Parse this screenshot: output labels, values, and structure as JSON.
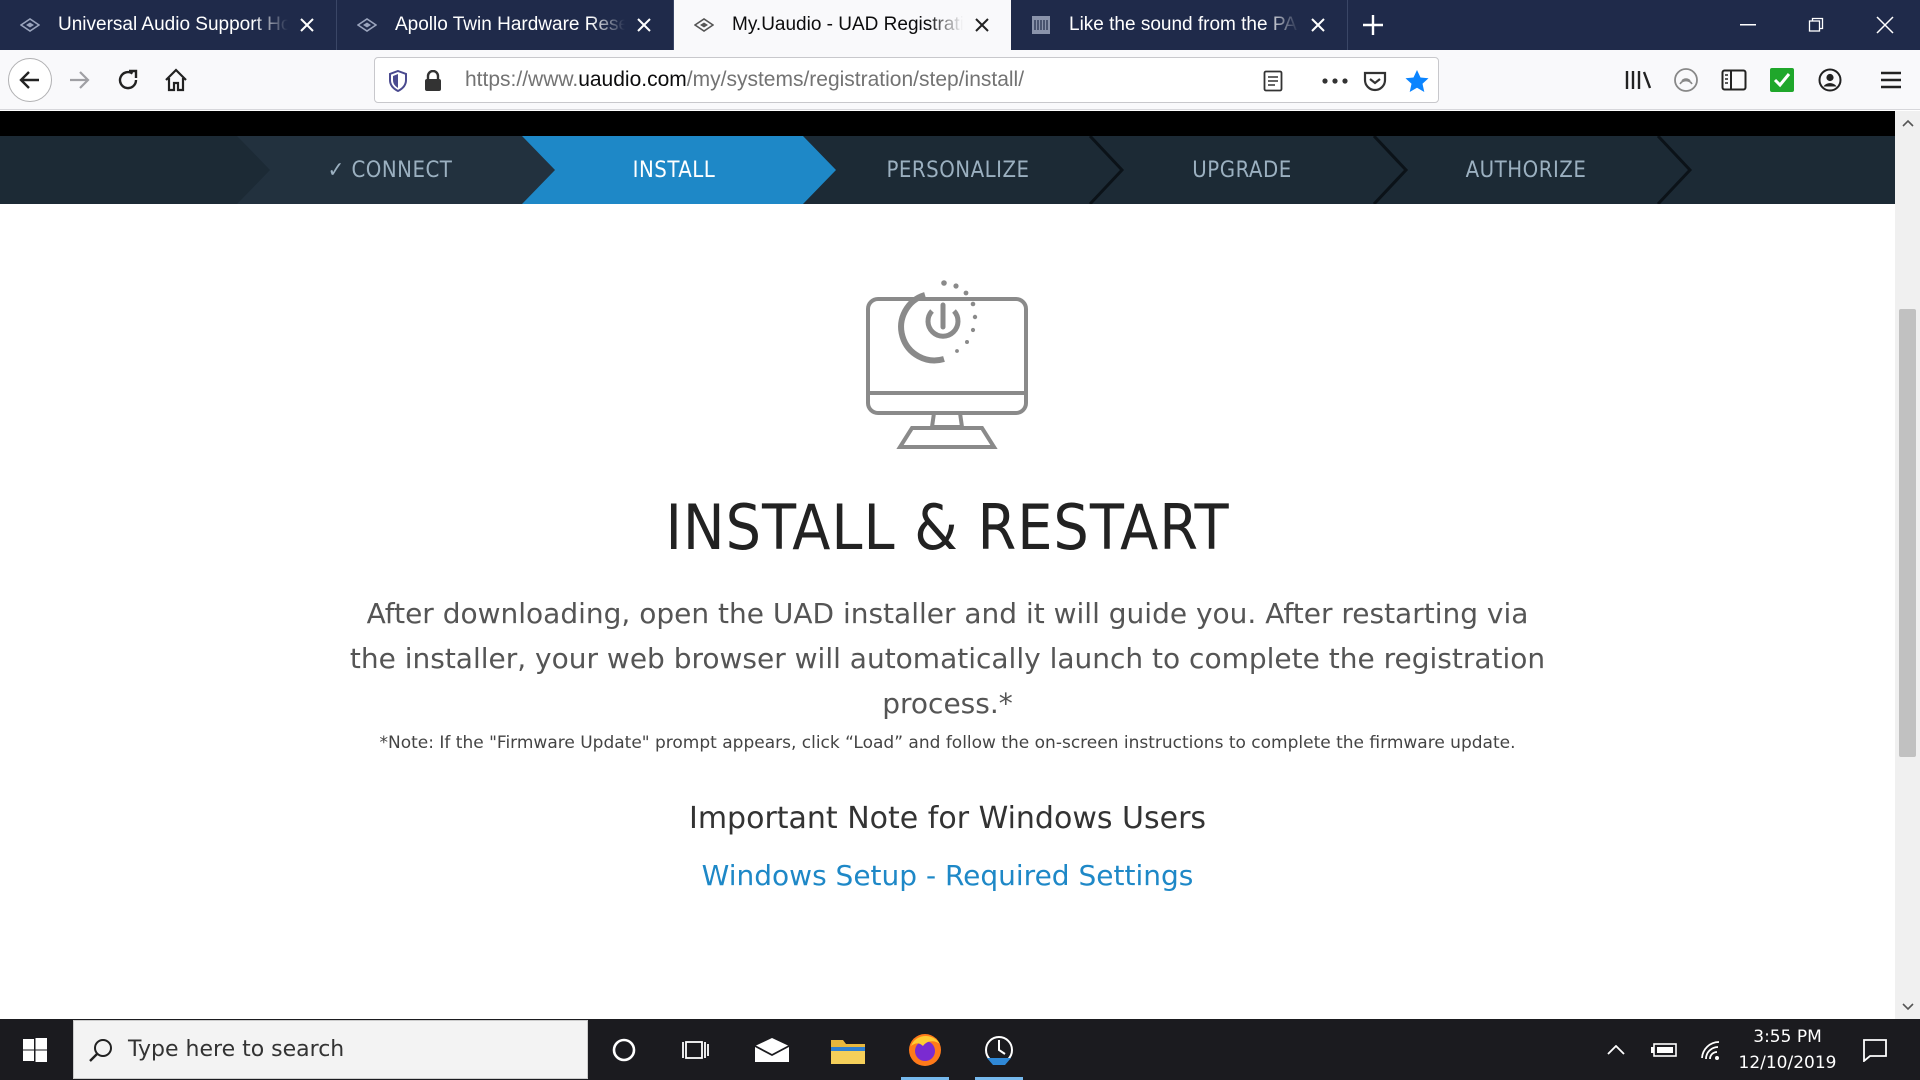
{
  "browser": {
    "tabs": [
      {
        "title": "Universal Audio Support Home",
        "active": false
      },
      {
        "title": "Apollo Twin Hardware Reset – Universal Audio",
        "active": false
      },
      {
        "title": "My.Uaudio - UAD Registration",
        "active": true
      },
      {
        "title": "Like the sound from the PA but",
        "active": false
      }
    ],
    "url_prefix": "https://www.",
    "url_domain": "uaudio.com",
    "url_path": "/my/systems/registration/step/install/"
  },
  "steps": [
    {
      "label": "✓ CONNECT",
      "state": "done"
    },
    {
      "label": "INSTALL",
      "state": "active"
    },
    {
      "label": "PERSONALIZE",
      "state": "pending"
    },
    {
      "label": "UPGRADE",
      "state": "pending"
    },
    {
      "label": "AUTHORIZE",
      "state": "pending"
    }
  ],
  "content": {
    "title": "INSTALL & RESTART",
    "intro": "After downloading, open the UAD installer and it will guide you. After restarting via the installer, your web browser will automatically launch to complete the registration process.*",
    "firmware_note": "*Note: If the \"Firmware Update\" prompt appears, click “Load” and follow the on-screen instructions to complete the firmware update.",
    "windows_heading": "Important Note for Windows Users",
    "windows_link": "Windows Setup - Required Settings"
  },
  "taskbar": {
    "search_placeholder": "Type here to search",
    "time": "3:55 PM",
    "date": "12/10/2019"
  },
  "colors": {
    "tabstrip": "#1f2a4a",
    "stepbar": "#1c2a35",
    "step_active": "#1e88c7",
    "link": "#1e88c7",
    "taskbar": "#1b1b1f"
  }
}
